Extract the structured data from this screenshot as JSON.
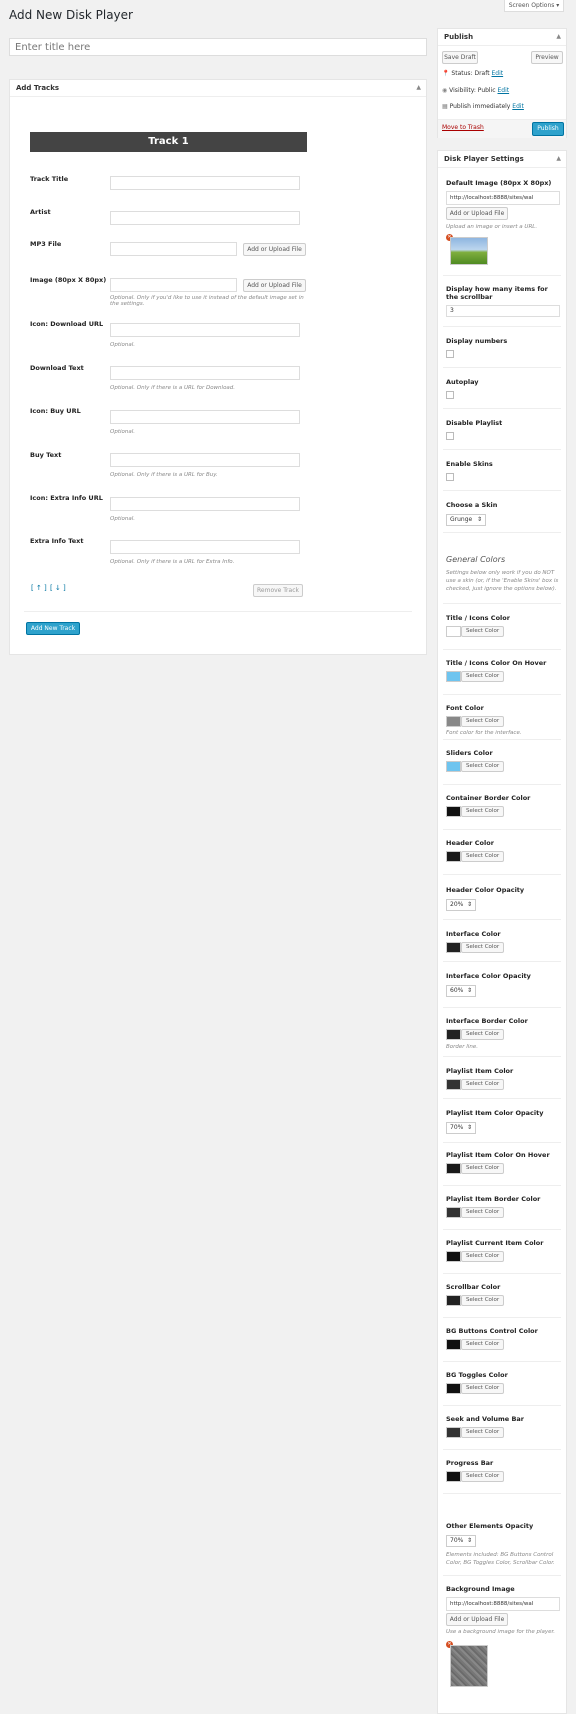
{
  "header": {
    "page_title": "Add New Disk Player",
    "screen_options": "Screen Options"
  },
  "title_input": {
    "placeholder": "Enter title here"
  },
  "add_tracks": {
    "heading": "Add Tracks",
    "track_heading": "Track 1",
    "fields": {
      "track_title": "Track Title",
      "artist": "Artist",
      "mp3_file": "MP3 File",
      "image": "Image (80px X 80px)",
      "icon_download_url": "Icon: Download URL",
      "download_text": "Download Text",
      "icon_buy_url": "Icon: Buy URL",
      "buy_text": "Buy Text",
      "icon_extra_info_url": "Icon: Extra Info URL",
      "extra_info_text": "Extra Info Text"
    },
    "upload_button": "Add or Upload File",
    "hints": {
      "image": "Optional. Only if you'd like to use it instead of the default image set in the settings.",
      "download_url": "Optional.",
      "download_text": "Optional. Only if there is a URL for Download.",
      "buy_url": "Optional.",
      "buy_text": "Optional. Only if there is a URL for Buy.",
      "extra_url": "Optional.",
      "extra_text": "Optional. Only if there is a URL for Extra Info."
    },
    "move_up": "[ ↑ ]",
    "move_down": "[ ↓ ]",
    "remove_track": "Remove Track",
    "add_new_track": "Add New Track"
  },
  "publish": {
    "heading": "Publish",
    "save_draft": "Save Draft",
    "preview": "Preview",
    "status_label": "Status: Draft",
    "visibility_label": "Visibility: Public",
    "publish_label": "Publish immediately",
    "edit": "Edit",
    "move_to_trash": "Move to Trash",
    "publish_button": "Publish"
  },
  "settings": {
    "heading": "Disk Player Settings",
    "default_image": {
      "label": "Default Image (80px X 80px)",
      "value": "http://localhost:8888/sites/wal",
      "button": "Add or Upload File",
      "hint": "Upload an image or insert a URL."
    },
    "display_items": {
      "label": "Display how many items for the scrollbar",
      "value": "3"
    },
    "display_numbers": "Display numbers",
    "autoplay": "Autoplay",
    "disable_playlist": "Disable Playlist",
    "enable_skins": "Enable Skins",
    "choose_skin": {
      "label": "Choose a Skin",
      "value": "Grunge"
    },
    "general_colors": {
      "heading": "General Colors",
      "note": "Settings below only work if you do NOT use a skin (or, if the 'Enable Skins' box is checked, just ignore the options below)."
    },
    "select_color": "Select Color",
    "colors": [
      {
        "label": "Title / Icons Color",
        "color": "#ffffff",
        "hint": ""
      },
      {
        "label": "Title / Icons Color On Hover",
        "color": "#6ec4ef",
        "hint": ""
      },
      {
        "label": "Font Color",
        "color": "#888888",
        "hint": "Font color for the interface."
      },
      {
        "label": "Sliders Color",
        "color": "#6ec4ef",
        "hint": ""
      },
      {
        "label": "Container Border Color",
        "color": "#111111",
        "hint": ""
      },
      {
        "label": "Header Color",
        "color": "#1a1a1a",
        "hint": ""
      }
    ],
    "header_opacity": {
      "label": "Header Color Opacity",
      "value": "20%"
    },
    "interface_color": {
      "label": "Interface Color",
      "color": "#222222"
    },
    "interface_opacity": {
      "label": "Interface Color Opacity",
      "value": "60%"
    },
    "interface_border": {
      "label": "Interface Border Color",
      "color": "#222222",
      "hint": "Border line."
    },
    "playlist_item_color": {
      "label": "Playlist Item Color",
      "color": "#333333"
    },
    "playlist_item_opacity": {
      "label": "Playlist Item Color Opacity",
      "value": "70%"
    },
    "colors2": [
      {
        "label": "Playlist Item Color On Hover",
        "color": "#1a1a1a"
      },
      {
        "label": "Playlist Item Border Color",
        "color": "#333333"
      },
      {
        "label": "Playlist Current Item Color",
        "color": "#111111"
      },
      {
        "label": "Scrollbar Color",
        "color": "#222222"
      },
      {
        "label": "BG Buttons Control Color",
        "color": "#111111"
      },
      {
        "label": "BG Toggles Color",
        "color": "#111111"
      },
      {
        "label": "Seek and Volume Bar",
        "color": "#333333"
      },
      {
        "label": "Progress Bar",
        "color": "#111111"
      }
    ],
    "other_opacity": {
      "label": "Other Elements Opacity",
      "value": "70%",
      "hint": "Elements included: BG Buttons Control Color, BG Toggles Color, Scrollbar Color."
    },
    "background_image": {
      "label": "Background Image",
      "value": "http://localhost:8888/sites/wal",
      "button": "Add or Upload File",
      "hint": "Use a background image for the player."
    }
  }
}
